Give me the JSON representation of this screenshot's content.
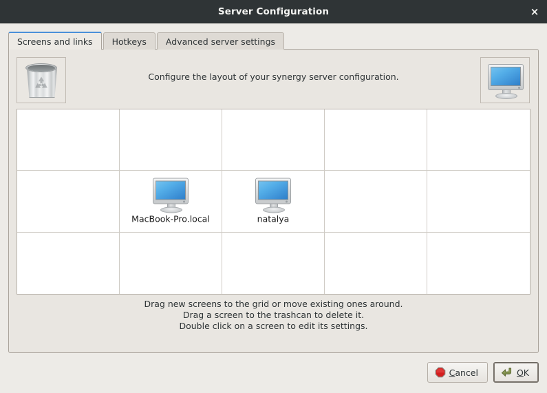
{
  "window": {
    "title": "Server Configuration",
    "close_label": "×"
  },
  "tabs": [
    {
      "label": "Screens and links",
      "active": true
    },
    {
      "label": "Hotkeys",
      "active": false
    },
    {
      "label": "Advanced server settings",
      "active": false
    }
  ],
  "toolbar": {
    "trash_icon": "trashcan-icon",
    "new_screen_icon": "monitor-icon",
    "header_text": "Configure the layout of your synergy server configuration."
  },
  "grid": {
    "columns": 5,
    "rows": 3,
    "screens": [
      {
        "row": 1,
        "col": 1,
        "label": "MacBook-Pro.local",
        "icon": "monitor-icon"
      },
      {
        "row": 1,
        "col": 2,
        "label": "natalya",
        "icon": "monitor-icon"
      }
    ]
  },
  "hints": {
    "line1": "Drag new screens to the grid or move existing ones around.",
    "line2": "Drag a screen to the trashcan to delete it.",
    "line3": "Double click on a screen to edit its settings."
  },
  "buttons": {
    "cancel": {
      "label": "Cancel",
      "mnemonic": "C",
      "icon": "stop-octagon-icon",
      "icon_color": "#d41f1f"
    },
    "ok": {
      "label": "OK",
      "mnemonic": "O",
      "icon": "enter-arrow-icon",
      "icon_color": "#7a8a46",
      "focused": true
    }
  },
  "colors": {
    "titlebar_bg": "#2f3436",
    "titlebar_fg": "#f4f4f2",
    "dialog_bg": "#edebe7",
    "panel_bg": "#e9e6e1",
    "tab_active_accent": "#4a90d9",
    "grid_bg": "#ffffff",
    "grid_line": "#cfcbc5",
    "screen_blue": "#54aee8"
  }
}
